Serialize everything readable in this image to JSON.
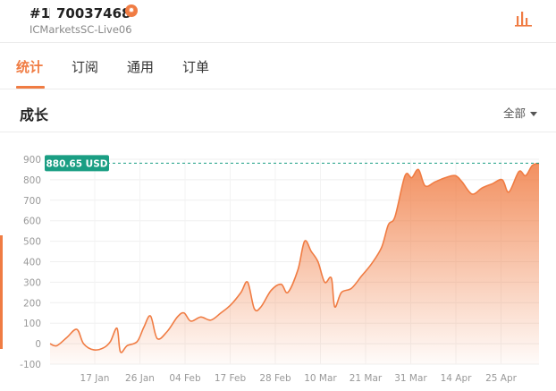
{
  "header": {
    "rank": "#1",
    "account_number": "70037468",
    "server": "ICMarketsSC-Live06",
    "badge_icon": "fire-icon",
    "stats_icon": "bar-chart-icon"
  },
  "tabs": [
    {
      "label": "统计",
      "active": true
    },
    {
      "label": "订阅",
      "active": false
    },
    {
      "label": "通用",
      "active": false
    },
    {
      "label": "订单",
      "active": false
    }
  ],
  "section": {
    "title": "成长",
    "filter_label": "全部"
  },
  "colors": {
    "accent": "#f07c43",
    "badge": "#1a9e83",
    "line": "#f07c43"
  },
  "chart_data": {
    "type": "area",
    "current_value_label": "880.65 USD",
    "current_value": 880.65,
    "ylim": [
      -100,
      900
    ],
    "yticks": [
      900,
      800,
      700,
      600,
      500,
      400,
      300,
      200,
      100,
      0,
      -100
    ],
    "xtick_labels": [
      "17 Jan",
      "26 Jan",
      "04 Feb",
      "17 Feb",
      "28 Feb",
      "10 Mar",
      "21 Mar",
      "31 Mar",
      "14 Apr",
      "25 Apr"
    ],
    "grid": true,
    "points": [
      {
        "x": 0,
        "y": 0
      },
      {
        "x": 2,
        "y": -10
      },
      {
        "x": 5,
        "y": 30
      },
      {
        "x": 8,
        "y": 70
      },
      {
        "x": 10,
        "y": 0
      },
      {
        "x": 13,
        "y": -30
      },
      {
        "x": 16,
        "y": -20
      },
      {
        "x": 18,
        "y": 10
      },
      {
        "x": 20,
        "y": 75
      },
      {
        "x": 21,
        "y": -40
      },
      {
        "x": 23,
        "y": -10
      },
      {
        "x": 26,
        "y": 10
      },
      {
        "x": 28,
        "y": 80
      },
      {
        "x": 30,
        "y": 135
      },
      {
        "x": 32,
        "y": 25
      },
      {
        "x": 35,
        "y": 60
      },
      {
        "x": 38,
        "y": 130
      },
      {
        "x": 40,
        "y": 150
      },
      {
        "x": 42,
        "y": 110
      },
      {
        "x": 45,
        "y": 130
      },
      {
        "x": 48,
        "y": 115
      },
      {
        "x": 51,
        "y": 150
      },
      {
        "x": 54,
        "y": 190
      },
      {
        "x": 57,
        "y": 250
      },
      {
        "x": 59,
        "y": 300
      },
      {
        "x": 61,
        "y": 170
      },
      {
        "x": 63,
        "y": 180
      },
      {
        "x": 66,
        "y": 260
      },
      {
        "x": 69,
        "y": 290
      },
      {
        "x": 71,
        "y": 250
      },
      {
        "x": 74,
        "y": 360
      },
      {
        "x": 76,
        "y": 500
      },
      {
        "x": 78,
        "y": 450
      },
      {
        "x": 80,
        "y": 400
      },
      {
        "x": 82,
        "y": 300
      },
      {
        "x": 84,
        "y": 320
      },
      {
        "x": 85,
        "y": 180
      },
      {
        "x": 87,
        "y": 250
      },
      {
        "x": 90,
        "y": 270
      },
      {
        "x": 93,
        "y": 330
      },
      {
        "x": 96,
        "y": 390
      },
      {
        "x": 99,
        "y": 470
      },
      {
        "x": 101,
        "y": 580
      },
      {
        "x": 103,
        "y": 620
      },
      {
        "x": 106,
        "y": 820
      },
      {
        "x": 108,
        "y": 810
      },
      {
        "x": 110,
        "y": 850
      },
      {
        "x": 112,
        "y": 770
      },
      {
        "x": 115,
        "y": 790
      },
      {
        "x": 118,
        "y": 810
      },
      {
        "x": 121,
        "y": 820
      },
      {
        "x": 123,
        "y": 790
      },
      {
        "x": 126,
        "y": 730
      },
      {
        "x": 129,
        "y": 760
      },
      {
        "x": 132,
        "y": 780
      },
      {
        "x": 135,
        "y": 800
      },
      {
        "x": 137,
        "y": 740
      },
      {
        "x": 140,
        "y": 840
      },
      {
        "x": 142,
        "y": 820
      },
      {
        "x": 144,
        "y": 870
      },
      {
        "x": 146,
        "y": 880
      }
    ]
  }
}
